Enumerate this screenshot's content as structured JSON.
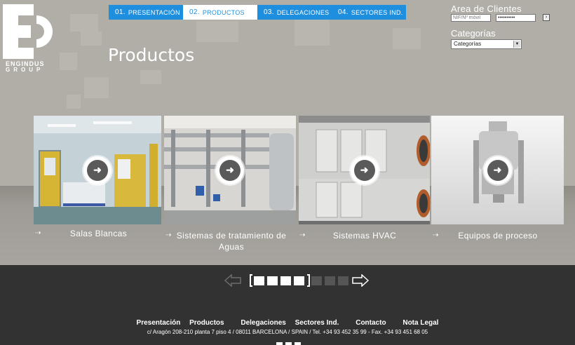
{
  "brand": {
    "line1": "ENGINDUS",
    "line2": "GROUP"
  },
  "nav": {
    "tabs": [
      {
        "num": "01.",
        "label": "PRESENTACIÓN"
      },
      {
        "num": "02.",
        "label": "PRODUCTOS"
      },
      {
        "num": "03.",
        "label": "DELEGACIONES"
      },
      {
        "num": "04.",
        "label": "SECTORES IND."
      }
    ],
    "active_index": 1
  },
  "client_area": {
    "heading": "Area de Clientes",
    "nif_placeholder": "NIF/Nº móvil",
    "password_value": "••••••••••",
    "go_label": "›"
  },
  "categories": {
    "label": "Categorías",
    "selected": "Categorías"
  },
  "page": {
    "title": "Productos"
  },
  "products": [
    {
      "name": "Salas Blancas"
    },
    {
      "name": "Sistemas de tratamiento de Aguas"
    },
    {
      "name": "Sistemas HVAC"
    },
    {
      "name": "Equipos de proceso"
    }
  ],
  "pager": {
    "total": 7,
    "active": 4
  },
  "footer": {
    "links": [
      "Presentación",
      "Productos",
      "Delegaciones",
      "Sectores Ind.",
      "Contacto",
      "Nota Legal"
    ],
    "address": "c/ Aragón 208-210 planta 7 piso 4 / 08011 BARCELONA / SPAIN / Tel. +34 93 452 35 99 - Fax. +34 93 451 68 05"
  },
  "colors": {
    "accent": "#1e8fde",
    "background": "#b1aea8",
    "footer": "#323232"
  }
}
